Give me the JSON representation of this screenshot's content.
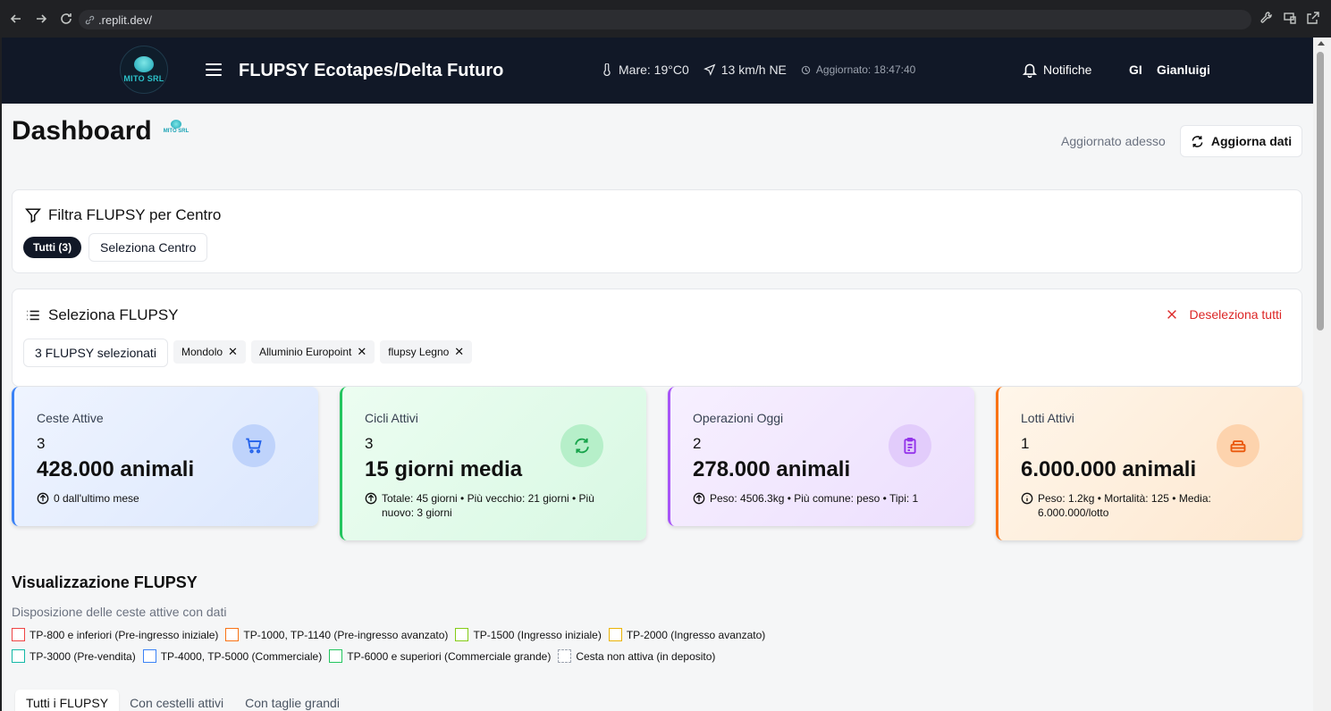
{
  "browser": {
    "url": ".replit.dev/"
  },
  "header": {
    "logo_text": "MITO SRL",
    "title": "FLUPSY Ecotapes/Delta Futuro",
    "sea_temp": "Mare: 19°C0",
    "wind": "13 km/h NE",
    "updated": "Aggiornato: 18:47:40",
    "notifications": "Notifiche",
    "user_initials": "GI",
    "user_name": "Gianluigi"
  },
  "page": {
    "title": "Dashboard",
    "mini_logo_text": "MITO SRL",
    "updated_now": "Aggiornato adesso",
    "refresh_label": "Aggiorna dati"
  },
  "filter": {
    "title": "Filtra FLUPSY per Centro",
    "all_chip": "Tutti (3)",
    "select_center": "Seleziona Centro"
  },
  "selection": {
    "title": "Seleziona FLUPSY",
    "deselect_all": "Deseleziona tutti",
    "count_label": "3 FLUPSY selezionati",
    "chips": [
      {
        "label": "Mondolo"
      },
      {
        "label": "Alluminio Europoint"
      },
      {
        "label": "flupsy Legno"
      }
    ]
  },
  "stats": [
    {
      "label": "Ceste Attive",
      "count": "3",
      "value": "428.000 animali",
      "sub": "0 dall'ultimo mese",
      "icon": "cart-icon"
    },
    {
      "label": "Cicli Attivi",
      "count": "3",
      "value": "15 giorni media",
      "sub": "Totale: 45 giorni • Più vecchio: 21 giorni • Più nuovo: 3 giorni",
      "icon": "refresh-icon"
    },
    {
      "label": "Operazioni Oggi",
      "count": "2",
      "value": "278.000 animali",
      "sub": "Peso: 4506.3kg • Più comune: peso • Tipi: 1",
      "icon": "clipboard-icon"
    },
    {
      "label": "Lotti Attivi",
      "count": "1",
      "value": "6.000.000 animali",
      "sub": "Peso: 1.2kg • Mortalità: 125 • Media: 6.000.000/lotto",
      "icon": "box-icon"
    }
  ],
  "visualization": {
    "title": "Visualizzazione FLUPSY",
    "subtitle": "Disposizione delle ceste attive con dati",
    "legend": [
      {
        "label": "TP-800 e inferiori (Pre-ingresso iniziale)",
        "color": "#ef4444"
      },
      {
        "label": "TP-1000, TP-1140 (Pre-ingresso avanzato)",
        "color": "#f97316"
      },
      {
        "label": "TP-1500 (Ingresso iniziale)",
        "color": "#84cc16"
      },
      {
        "label": "TP-2000 (Ingresso avanzato)",
        "color": "#eab308"
      },
      {
        "label": "TP-3000 (Pre-vendita)",
        "color": "#14b8a6"
      },
      {
        "label": "TP-4000, TP-5000 (Commerciale)",
        "color": "#3b82f6"
      },
      {
        "label": "TP-6000 e superiori (Commerciale grande)",
        "color": "#22c55e"
      },
      {
        "label": "Cesta non attiva (in deposito)",
        "color": "#9ca3af"
      }
    ],
    "tabs": [
      {
        "label": "Tutti i FLUPSY"
      },
      {
        "label": "Con cestelli attivi"
      },
      {
        "label": "Con taglie grandi"
      }
    ]
  }
}
